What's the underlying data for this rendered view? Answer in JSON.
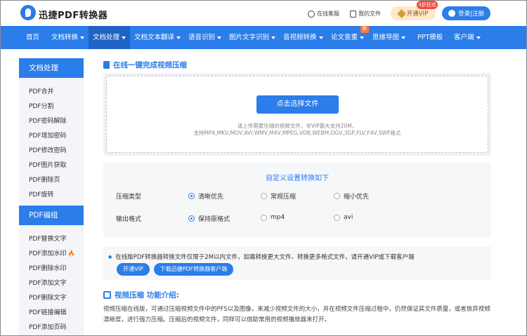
{
  "header": {
    "brand": "迅捷PDF转换器",
    "service_link": "在线客服",
    "myfiles_link": "我的文件",
    "vip_button": "开通VIP",
    "vip_badge": "3折狂欢",
    "login_button": "登录|注册"
  },
  "nav": {
    "items": [
      {
        "label": "首页",
        "dropdown": false
      },
      {
        "label": "文档转换",
        "dropdown": true
      },
      {
        "label": "文档处理",
        "dropdown": true,
        "active": true
      },
      {
        "label": "文档文本翻译",
        "dropdown": true
      },
      {
        "label": "语音识别",
        "dropdown": true
      },
      {
        "label": "图片文字识别",
        "dropdown": true
      },
      {
        "label": "音视频转换",
        "dropdown": true
      },
      {
        "label": "论文查重",
        "dropdown": true
      },
      {
        "label": "思维导图",
        "dropdown": true
      },
      {
        "label": "PPT模板",
        "dropdown": false
      },
      {
        "label": "客户端",
        "dropdown": true
      }
    ],
    "new_badge": "新"
  },
  "sidebar": {
    "group1_title": "文档处理",
    "group1_items": [
      "PDF合并",
      "PDF分割",
      "PDF密码解除",
      "PDF增加密码",
      "PDF修改密码",
      "PDF图片获取",
      "PDF删除页",
      "PDF旋转"
    ],
    "group2_title": "PDF编组",
    "group2_items": [
      "PDF替换文字",
      "PDF添加水印",
      "PDF删除水印",
      "PDF添加文字",
      "PDF删除文字",
      "PDF链接编辑",
      "PDF添加页码"
    ]
  },
  "main": {
    "section_title": "在线一键完成视频压缩",
    "choose_button": "点击选择文件",
    "hint_line1": "请上传需要压缩的视频文件，非VIP最大支持20M，",
    "hint_line2": "支持MP4,MKV,MOV,AVI,WMV,M4V,MPEG,VOB,WEBM,OGV,3GP,FLV,F4V,SWF格式",
    "settings_title": "自定义设置转换如下",
    "compress_label": "压缩类型",
    "compress_options": [
      "清晰优先",
      "常规压缩",
      "缩小优先"
    ],
    "compress_selected": "清晰优先",
    "format_label": "输出格式",
    "format_options": [
      "保持原格式",
      "mp4",
      "avi"
    ],
    "format_selected": "保持原格式",
    "notice": "在线版PDF转换器转换文件仅限于2M以内文件，如需转换更大文件、转换更多格式文件，请开通VIP或下载客户端",
    "vip_pill": "开通VIP",
    "download_pill": "下载迅捷PDF转换器客户端",
    "intro_title": "视频压缩 功能介绍:",
    "intro_text": "视频压缩在线版，可通过压缩视频文件中的PFS以及图像，来减少视频文件的大小，并在视频文件压缩过程中，仍然保证其文件质量，或者放弃视频清晰度，进行强力压缩。压缩后的视频文件，同样可以借助常用的视频播放器来打开。"
  }
}
